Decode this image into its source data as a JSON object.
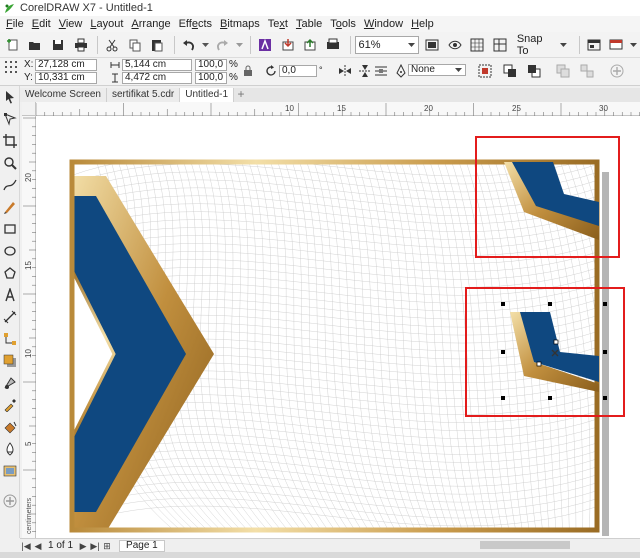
{
  "window": {
    "title": "CorelDRAW X7 - Untitled-1"
  },
  "menu": {
    "items": [
      {
        "label": "File",
        "u": "F",
        "rest": "ile"
      },
      {
        "label": "Edit",
        "u": "E",
        "rest": "dit"
      },
      {
        "label": "View",
        "u": "V",
        "rest": "iew"
      },
      {
        "label": "Layout",
        "u": "L",
        "rest": "ayout"
      },
      {
        "label": "Arrange",
        "u": "A",
        "rest": "rrange"
      },
      {
        "label": "Effects",
        "u": "E",
        "rest": "ffects",
        "pre": "Eff",
        "post": "cts"
      },
      {
        "label": "Bitmaps",
        "u": "B",
        "rest": "itmaps"
      },
      {
        "label": "Text",
        "u": "x",
        "pre": "Te",
        "post": "t"
      },
      {
        "label": "Table",
        "u": "T",
        "rest": "able"
      },
      {
        "label": "Tools",
        "u": "o",
        "pre": "T",
        "post": "ols"
      },
      {
        "label": "Window",
        "u": "W",
        "rest": "indow"
      },
      {
        "label": "Help",
        "u": "H",
        "rest": "elp"
      }
    ]
  },
  "toolbar": {
    "zoom_value": "61%",
    "snap_label": "Snap To"
  },
  "property_bar": {
    "x_label": "X:",
    "x_value": "27,128 cm",
    "y_label": "Y:",
    "y_value": "10,331 cm",
    "width_value": "5,144 cm",
    "height_value": "4,472 cm",
    "scale_w": "100,0",
    "scale_h": "100,0",
    "percent": "%",
    "rotation_value": "0,0",
    "outline_value": "None"
  },
  "tabs": {
    "items": [
      {
        "label": "Welcome Screen",
        "active": false
      },
      {
        "label": "sertifikat 5.cdr",
        "active": false
      },
      {
        "label": "Untitled-1",
        "active": true
      }
    ],
    "add_label": "+"
  },
  "rulers": {
    "h_labels": [
      "10",
      "15",
      "20",
      "25",
      "30"
    ],
    "v_labels": [
      "20",
      "15",
      "10",
      "5"
    ],
    "units_label": "centimeters"
  },
  "page_nav": {
    "page_count": "1 of 1",
    "page_tab": "Page 1"
  },
  "colors": {
    "navy": "#0f4880",
    "gold_light": "#f3dfa8",
    "gold_dark": "#9a6c24",
    "highlight_red": "#e31c1c"
  }
}
